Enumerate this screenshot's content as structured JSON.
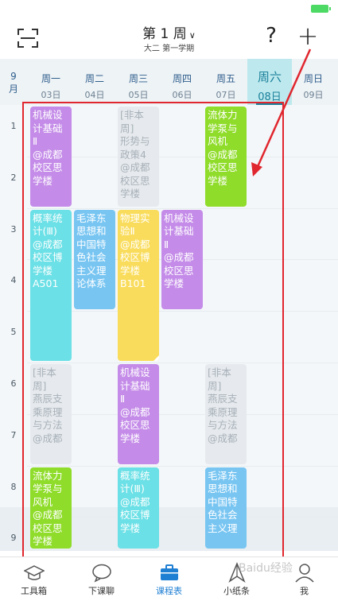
{
  "header": {
    "week_title": "第 1 周",
    "semester": "大二  第一学期",
    "help_label": "?",
    "add_label": "+"
  },
  "calendar": {
    "month_lines": [
      "9",
      "月"
    ],
    "days": [
      {
        "name": "周一",
        "date": "03日"
      },
      {
        "name": "周二",
        "date": "04日"
      },
      {
        "name": "周三",
        "date": "05日"
      },
      {
        "name": "周四",
        "date": "06日"
      },
      {
        "name": "周五",
        "date": "07日"
      },
      {
        "name": "周六",
        "date": "08日"
      },
      {
        "name": "周日",
        "date": "09日"
      }
    ],
    "today_index": 5,
    "periods": [
      "1",
      "2",
      "3",
      "4",
      "5",
      "6",
      "7",
      "8",
      "9"
    ]
  },
  "courses": [
    {
      "id": "c1",
      "day": 1,
      "start": 1,
      "span": 2,
      "color": "purple",
      "lines": [
        "机械设",
        "计基础",
        "Ⅱ",
        "@成都",
        "校区思",
        "学楼"
      ]
    },
    {
      "id": "c2",
      "day": 3,
      "start": 1,
      "span": 2,
      "color": "gray",
      "lines": [
        "[非本",
        "周]",
        "形势与",
        "政策4",
        "@成都",
        "校区思",
        "学楼"
      ]
    },
    {
      "id": "c3",
      "day": 5,
      "start": 1,
      "span": 2,
      "color": "green",
      "lines": [
        "流体力",
        "学泵与",
        "风机",
        "@成都",
        "校区思",
        "学楼"
      ]
    },
    {
      "id": "c4",
      "day": 1,
      "start": 3,
      "span": 3,
      "color": "cyan",
      "lines": [
        "概率统",
        "计(Ⅲ)",
        "@成都",
        "校区博",
        "学楼",
        "A501"
      ]
    },
    {
      "id": "c5",
      "day": 2,
      "start": 3,
      "span": 2,
      "color": "blue",
      "lines": [
        "毛泽东",
        "思想和",
        "中国特",
        "色社会",
        "主义理",
        "论体系"
      ]
    },
    {
      "id": "c6",
      "day": 3,
      "start": 3,
      "span": 3,
      "color": "yellow",
      "lines": [
        "物理实",
        "验Ⅱ",
        "@成都",
        "校区博",
        "学楼",
        "B101"
      ]
    },
    {
      "id": "c7",
      "day": 4,
      "start": 3,
      "span": 2,
      "color": "purple",
      "lines": [
        "机械设",
        "计基础",
        "Ⅱ",
        "@成都",
        "校区思",
        "学楼"
      ]
    },
    {
      "id": "c8",
      "day": 1,
      "start": 6,
      "span": 2,
      "color": "gray",
      "lines": [
        "[非本",
        "周]",
        "燕辰支",
        "乘原理",
        "与方法",
        "@成都"
      ]
    },
    {
      "id": "c9",
      "day": 3,
      "start": 6,
      "span": 2,
      "color": "purple",
      "lines": [
        "机械设",
        "计基础",
        "Ⅱ",
        "@成都",
        "校区思",
        "学楼"
      ]
    },
    {
      "id": "c10",
      "day": 5,
      "start": 6,
      "span": 2,
      "color": "gray",
      "lines": [
        "[非本",
        "周]",
        "燕辰支",
        "乘原理",
        "与方法",
        "@成都"
      ]
    },
    {
      "id": "c11",
      "day": 1,
      "start": 8,
      "span": 2,
      "color": "green",
      "lines": [
        "流体力",
        "学泵与",
        "风机",
        "@成都",
        "校区思",
        "学楼"
      ]
    },
    {
      "id": "c12",
      "day": 3,
      "start": 8,
      "span": 2,
      "color": "cyan",
      "lines": [
        "概率统",
        "计(Ⅲ)",
        "@成都",
        "校区博",
        "学楼"
      ]
    },
    {
      "id": "c13",
      "day": 5,
      "start": 8,
      "span": 2,
      "color": "blue",
      "lines": [
        "毛泽东",
        "思想和",
        "中国特",
        "色社会",
        "主义理"
      ]
    }
  ],
  "tabs": [
    {
      "label": "工具箱",
      "icon": "graduation-cap-icon"
    },
    {
      "label": "下课聊",
      "icon": "chat-bubble-icon"
    },
    {
      "label": "课程表",
      "icon": "briefcase-icon"
    },
    {
      "label": "小纸条",
      "icon": "paper-plane-icon"
    },
    {
      "label": "我",
      "icon": "person-icon"
    }
  ],
  "active_tab": 2,
  "watermark": "Baidu经验",
  "colors": {
    "purple": "#c48ce8",
    "green": "#8fdc2a",
    "cyan": "#6be0e6",
    "blue": "#78c5f2",
    "yellow": "#f9dc5c",
    "gray": "#e6eaee",
    "today_highlight": "#bde9ee",
    "annotation_red": "#e0262e",
    "active_tab": "#1f7fd3"
  }
}
